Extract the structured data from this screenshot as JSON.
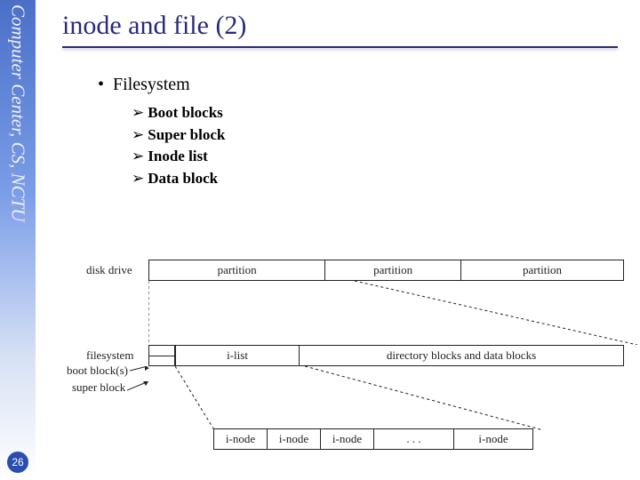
{
  "sidebar": {
    "label": "Computer Center, CS, NCTU"
  },
  "page_number": "26",
  "title": "inode and file (2)",
  "bullets": {
    "main": "Filesystem",
    "items": [
      "Boot blocks",
      "Super block",
      "Inode list",
      "Data block"
    ]
  },
  "diagram": {
    "disk_drive_label": "disk drive",
    "partitions": [
      "partition",
      "partition",
      "partition"
    ],
    "filesystem_label": "filesystem",
    "ilist": "i-list",
    "dblocks": "directory blocks and data blocks",
    "boot_block": "boot block(s)",
    "super_block": "super block",
    "inode": "i-node",
    "dots": ". . ."
  }
}
